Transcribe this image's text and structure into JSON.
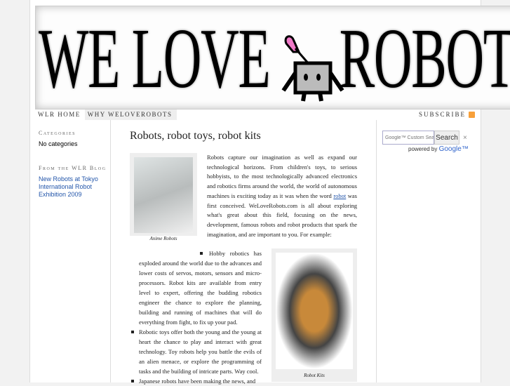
{
  "banner": {
    "logo_text": "WE LOVE ROBOTS",
    "left": "WE LOVE",
    "right": "ROBOTS"
  },
  "nav": [
    {
      "label": "WLR HOME"
    },
    {
      "label": "WHY WELOVEROBOTS"
    }
  ],
  "subscribe": "SUBSCRIBE",
  "sidebar": {
    "categories_title": "Categories",
    "categories_empty": "No categories",
    "blog_title": "From the WLR Blog",
    "blog_link": "New Robots at Tokyo International Robot Exhibition 2009"
  },
  "post": {
    "title": "Robots, robot toys, robot kits",
    "intro_before": "Robots capture our imagination as well as expand our technological horizons. From children's toys, to serious hobbyists, to the most technologically advanced electronics and robotics firms around the world, the world of autonomous machines is exciting today as it was when the word ",
    "intro_link": "robot",
    "intro_after": " was first conceived. WeLoveRobots.com is all about exploring what's great about this field, focusing on the news, development, famous robots and robot products that spark the imagination, and are important to you. For example:",
    "fig1_caption": "Anime Robots",
    "fig2_caption": "Robot Kits",
    "bullets": [
      "Hobby robotics has exploded around the world due to the advances and lower costs of servos, motors, sensors and micro-processors. Robot kits are available from entry level to expert, offering the budding robotics engineer the chance to explore the planning, building and running of machines that will do everything from fight, to fix up your pad.",
      "Robotic toys offer both the young and the young at heart the chance to play and interact with great technology. Toy robots help you battle the evils of an alien menace, or explore the programming of tasks and the building of intricate parts. Way cool.",
      "Japanese robots have been making the news, and"
    ]
  },
  "search": {
    "placeholder": "Google™ Custom Search",
    "button": "Search",
    "clear": "×",
    "powered_by": "powered by",
    "google": "Google™"
  }
}
